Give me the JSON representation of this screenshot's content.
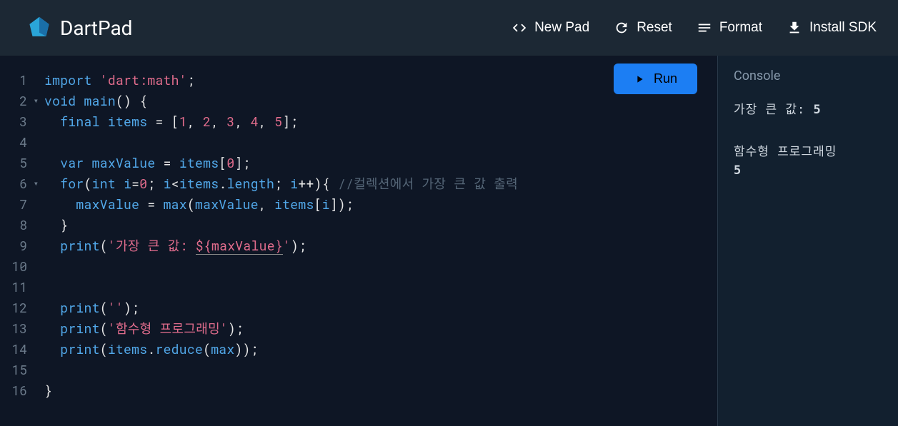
{
  "header": {
    "title": "DartPad",
    "buttons": {
      "new_pad": "New Pad",
      "reset": "Reset",
      "format": "Format",
      "install": "Install SDK"
    }
  },
  "run_button_label": "Run",
  "line_numbers": [
    "1",
    "2",
    "3",
    "4",
    "5",
    "6",
    "7",
    "8",
    "9",
    "10",
    "11",
    "12",
    "13",
    "14",
    "15",
    "16"
  ],
  "fold_lines": [
    2,
    6
  ],
  "code": {
    "l1": {
      "import": "import",
      "sp": " ",
      "str": "'dart:math'",
      "semi": ";"
    },
    "l2": {
      "void": "void",
      "sp": " ",
      "main": "main",
      "parens": "()",
      "sp2": " ",
      "brace": "{"
    },
    "l3": {
      "indent": "  ",
      "final": "final",
      "sp": " ",
      "items": "items",
      "sp2": " ",
      "eq": "=",
      "sp3": " ",
      "lb": "[",
      "n1": "1",
      "c1": ", ",
      "n2": "2",
      "c2": ", ",
      "n3": "3",
      "c3": ", ",
      "n4": "4",
      "c4": ", ",
      "n5": "5",
      "rb": "]",
      "semi": ";"
    },
    "l5": {
      "indent": "  ",
      "var": "var",
      "sp": " ",
      "maxValue": "maxValue",
      "sp2": " ",
      "eq": "=",
      "sp3": " ",
      "items": "items",
      "lb": "[",
      "zero": "0",
      "rb": "]",
      "semi": ";"
    },
    "l6": {
      "indent": "  ",
      "for": "for",
      "lp": "(",
      "int": "int",
      "sp": " ",
      "i": "i",
      "eq": "=",
      "zero": "0",
      "semi1": "; ",
      "i2": "i",
      "lt": "<",
      "items": "items",
      "dot": ".",
      "length": "length",
      "semi2": "; ",
      "i3": "i",
      "pp": "++",
      "rp": ")",
      "brace": "{",
      "sp2": " ",
      "comment": "//컬렉션에서 가장 큰 값 출력"
    },
    "l7": {
      "indent": "    ",
      "maxValue": "maxValue",
      "sp": " ",
      "eq": "=",
      "sp2": " ",
      "max": "max",
      "lp": "(",
      "mv": "maxValue",
      "c": ", ",
      "items": "items",
      "lb": "[",
      "i": "i",
      "rb": "]",
      "rp": ")",
      "semi": ";"
    },
    "l8": {
      "indent": "  ",
      "brace": "}"
    },
    "l9": {
      "indent": "  ",
      "print": "print",
      "lp": "(",
      "s1": "'가장 큰 값: ",
      "interp": "${maxValue}",
      "s2": "'",
      "rp": ")",
      "semi": ";"
    },
    "l12": {
      "indent": "  ",
      "print": "print",
      "lp": "(",
      "str": "''",
      "rp": ")",
      "semi": ";"
    },
    "l13": {
      "indent": "  ",
      "print": "print",
      "lp": "(",
      "str": "'함수형 프로그래밍'",
      "rp": ")",
      "semi": ";"
    },
    "l14": {
      "indent": "  ",
      "print": "print",
      "lp": "(",
      "items": "items",
      "dot": ".",
      "reduce": "reduce",
      "lp2": "(",
      "max": "max",
      "rp2": ")",
      "rp": ")",
      "semi": ";"
    },
    "l16": {
      "brace": "}"
    }
  },
  "console": {
    "title": "Console",
    "lines": [
      {
        "pre": "가장 큰 값: ",
        "bold": "5"
      },
      {
        "spacer": true
      },
      {
        "text": "함수형 프로그래밍"
      },
      {
        "bold": "5"
      }
    ]
  }
}
